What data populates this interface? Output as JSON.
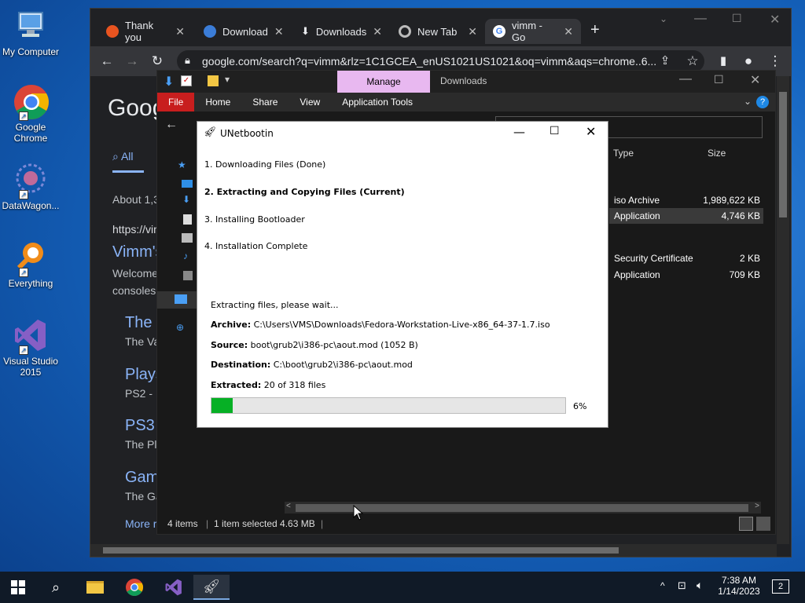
{
  "desktop": {
    "icons": [
      {
        "label": "My Computer"
      },
      {
        "label": "Google\nChrome"
      },
      {
        "label": "DataWagon..."
      },
      {
        "label": "Everything"
      },
      {
        "label": "Visual Studio\n2015"
      }
    ]
  },
  "chrome": {
    "tabs": [
      {
        "label": "Thank you"
      },
      {
        "label": "Download"
      },
      {
        "label": "Downloads"
      },
      {
        "label": "New Tab"
      },
      {
        "label": "vimm - Go"
      }
    ],
    "new_tab": "+",
    "url": "google.com/search?q=vimm&rlz=1C1GCEA_enUS1021US1021&oq=vimm&aqs=chrome..6...",
    "page": {
      "logo": "Goog",
      "all_tab": "All",
      "about": "About 1,3",
      "result_url": "https://vim",
      "result_title": "Vimm's",
      "result_snippet1": "Welcome",
      "result_snippet2": "consoles",
      "sub1_title": "The",
      "sub1_text": "The Va",
      "sub2_title": "Plays",
      "sub2_text": "PS2 - ",
      "sub3_title": "PS3",
      "sub3_text": "The Pl",
      "sub4_title": "Gam",
      "sub4_text": "The Ga",
      "more": "More r"
    }
  },
  "explorer": {
    "manage": "Manage",
    "title": "Downloads",
    "ribbon": [
      "File",
      "Home",
      "Share",
      "View",
      "Application Tools"
    ],
    "columns": {
      "type": "Type",
      "size": "Size"
    },
    "rows": [
      {
        "type": "iso Archive",
        "size": "1,989,622 KB"
      },
      {
        "type": "Application",
        "size": "4,746 KB"
      },
      {
        "type": "Security Certificate",
        "size": "2 KB"
      },
      {
        "type": "Application",
        "size": "709 KB"
      }
    ],
    "status": {
      "items": "4 items",
      "selected": "1 item selected  4.63 MB"
    }
  },
  "unetbootin": {
    "title": "UNetbootin",
    "steps": [
      "1. Downloading Files (Done)",
      "2. Extracting and Copying Files (Current)",
      "3. Installing Bootloader",
      "4. Installation Complete"
    ],
    "status_msg": "Extracting files, please wait...",
    "archive_label": "Archive:",
    "archive": "C:\\Users\\VMS\\Downloads\\Fedora-Workstation-Live-x86_64-37-1.7.iso",
    "source_label": "Source:",
    "source": "boot\\grub2\\i386-pc\\aout.mod (1052 B)",
    "dest_label": "Destination:",
    "dest": "C:\\boot\\grub2\\i386-pc\\aout.mod",
    "extracted_label": "Extracted:",
    "extracted": "20 of 318 files",
    "progress_text": "6%",
    "progress": 0.06
  },
  "taskbar": {
    "time": "7:38 AM",
    "date": "1/14/2023",
    "notif_count": "2"
  },
  "colors": {
    "accent": "#1a6fcf",
    "progress": "#06b025",
    "chrome_bg": "#202124",
    "link": "#8ab4f8"
  }
}
